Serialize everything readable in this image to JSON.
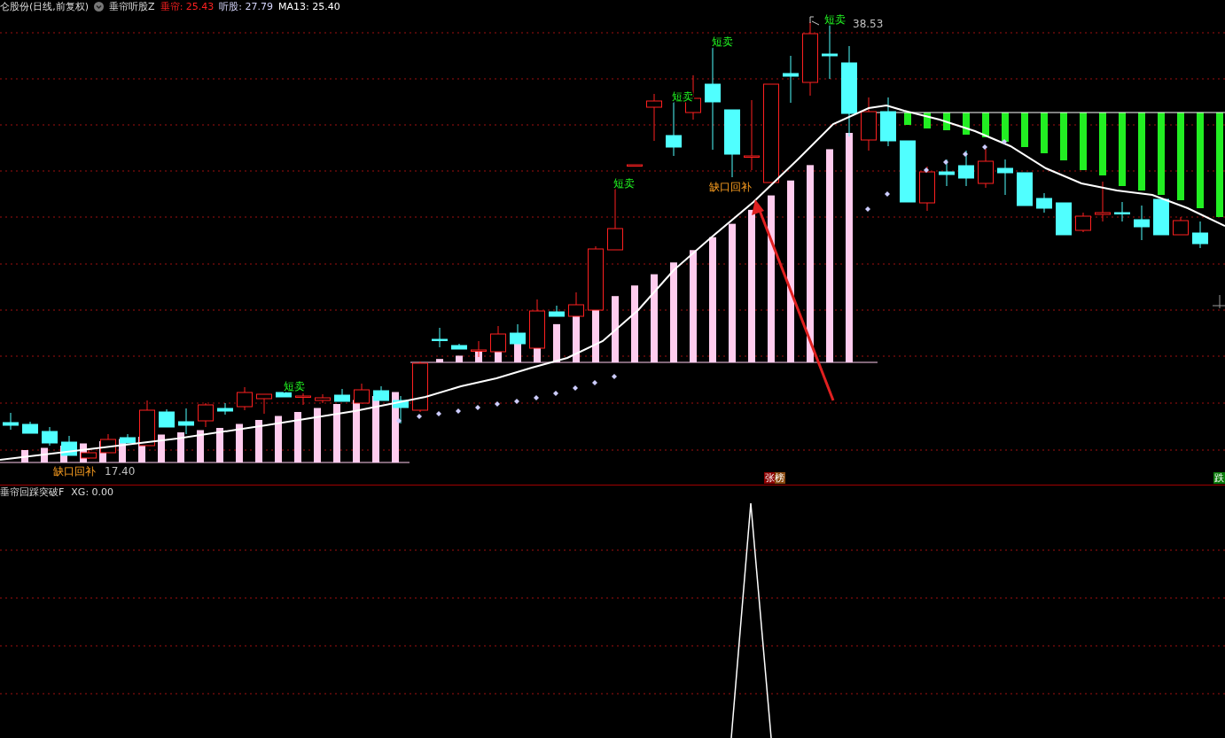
{
  "header": {
    "title": "仑股份(日线,前复权)",
    "indicator": "垂帘听股Z",
    "values": [
      {
        "text": "垂帘: 25.43",
        "color": "#ff2020"
      },
      {
        "text": "听股: 27.79",
        "color": "#d8d8ff"
      },
      {
        "text": "MA13: 25.40",
        "color": "#ffffff"
      }
    ]
  },
  "main_chart": {
    "labels": [
      {
        "kind": "sell",
        "text": "短卖"
      },
      {
        "kind": "sell",
        "text": "短卖"
      },
      {
        "kind": "sell",
        "text": "短卖"
      },
      {
        "kind": "sell",
        "text": "短卖"
      },
      {
        "kind": "sell",
        "text": "短卖"
      },
      {
        "kind": "gap",
        "text": "缺口回补"
      },
      {
        "kind": "gap",
        "text": "缺口回补"
      },
      {
        "kind": "price",
        "text": "38.53"
      },
      {
        "kind": "price",
        "text": "17.40"
      }
    ],
    "badges": [
      {
        "kind": "rise",
        "text": "张榜"
      },
      {
        "kind": "fall",
        "text": "跌"
      }
    ]
  },
  "lower_panel": {
    "name": "垂帘回踩突破F",
    "value": "XG: 0.00"
  }
}
